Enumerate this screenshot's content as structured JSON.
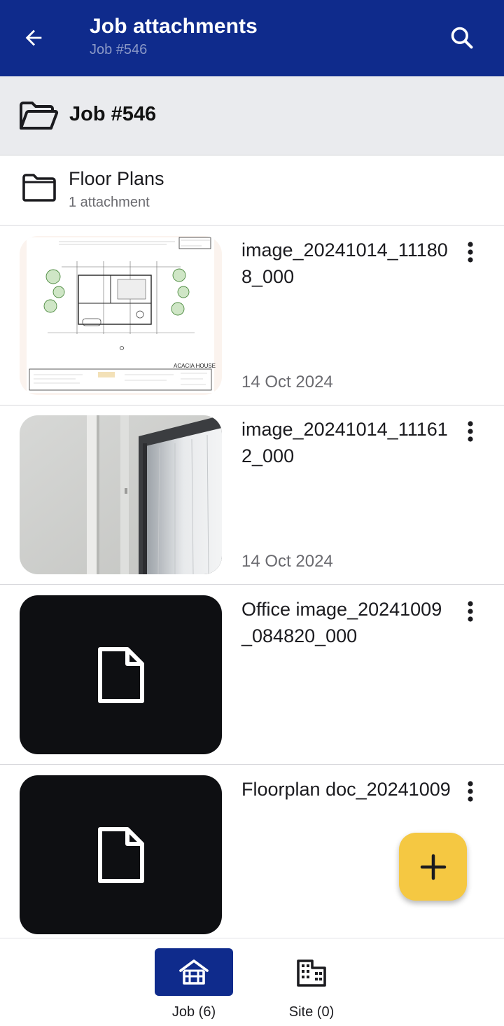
{
  "appbar": {
    "title": "Job attachments",
    "subtitle": "Job #546",
    "back_icon": "arrow-left-icon",
    "search_icon": "search-icon",
    "color": "#0f2b8c"
  },
  "folder": {
    "name": "Job #546",
    "icon": "folder-open-icon"
  },
  "subfolder": {
    "name": "Floor Plans",
    "count": "1 attachment",
    "icon": "folder-icon"
  },
  "attachments": [
    {
      "name": "image_20241014_111808_000",
      "date": "14 Oct 2024",
      "thumb": "floorplan-image",
      "plan_label": "ACACIA HOUSE"
    },
    {
      "name": "image_20241014_111612_000",
      "date": "14 Oct 2024",
      "thumb": "window-photo"
    },
    {
      "name": "Office image_20241009_084820_000",
      "date": "",
      "thumb": "document-icon"
    },
    {
      "name": "Floorplan doc_20241009",
      "date": "",
      "thumb": "document-icon"
    }
  ],
  "fab": {
    "icon": "plus-icon",
    "color": "#f5c842"
  },
  "nav": [
    {
      "label": "Job (6)",
      "icon": "house-icon",
      "active": true
    },
    {
      "label": "Site (0)",
      "icon": "building-icon",
      "active": false
    }
  ]
}
